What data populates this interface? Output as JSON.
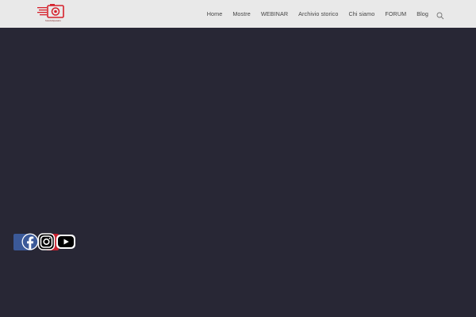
{
  "header": {
    "logo_text": "fotoclubpesaro",
    "nav": [
      {
        "label": "Home"
      },
      {
        "label": "Mostre"
      },
      {
        "label": "WEBINAR"
      },
      {
        "label": "Archivio storico"
      },
      {
        "label": "Chi siamo"
      },
      {
        "label": "FORUM"
      },
      {
        "label": "Blog"
      }
    ],
    "search_icon": "search-icon"
  },
  "social": {
    "icons": [
      "facebook-icon",
      "instagram-icon",
      "youtube-icon"
    ]
  },
  "colors": {
    "header_bg": "#e9e9e9",
    "page_bg": "#282735",
    "logo_red": "#d6202b",
    "facebook_blue": "#3b5998",
    "youtube_red": "#e52d27"
  }
}
